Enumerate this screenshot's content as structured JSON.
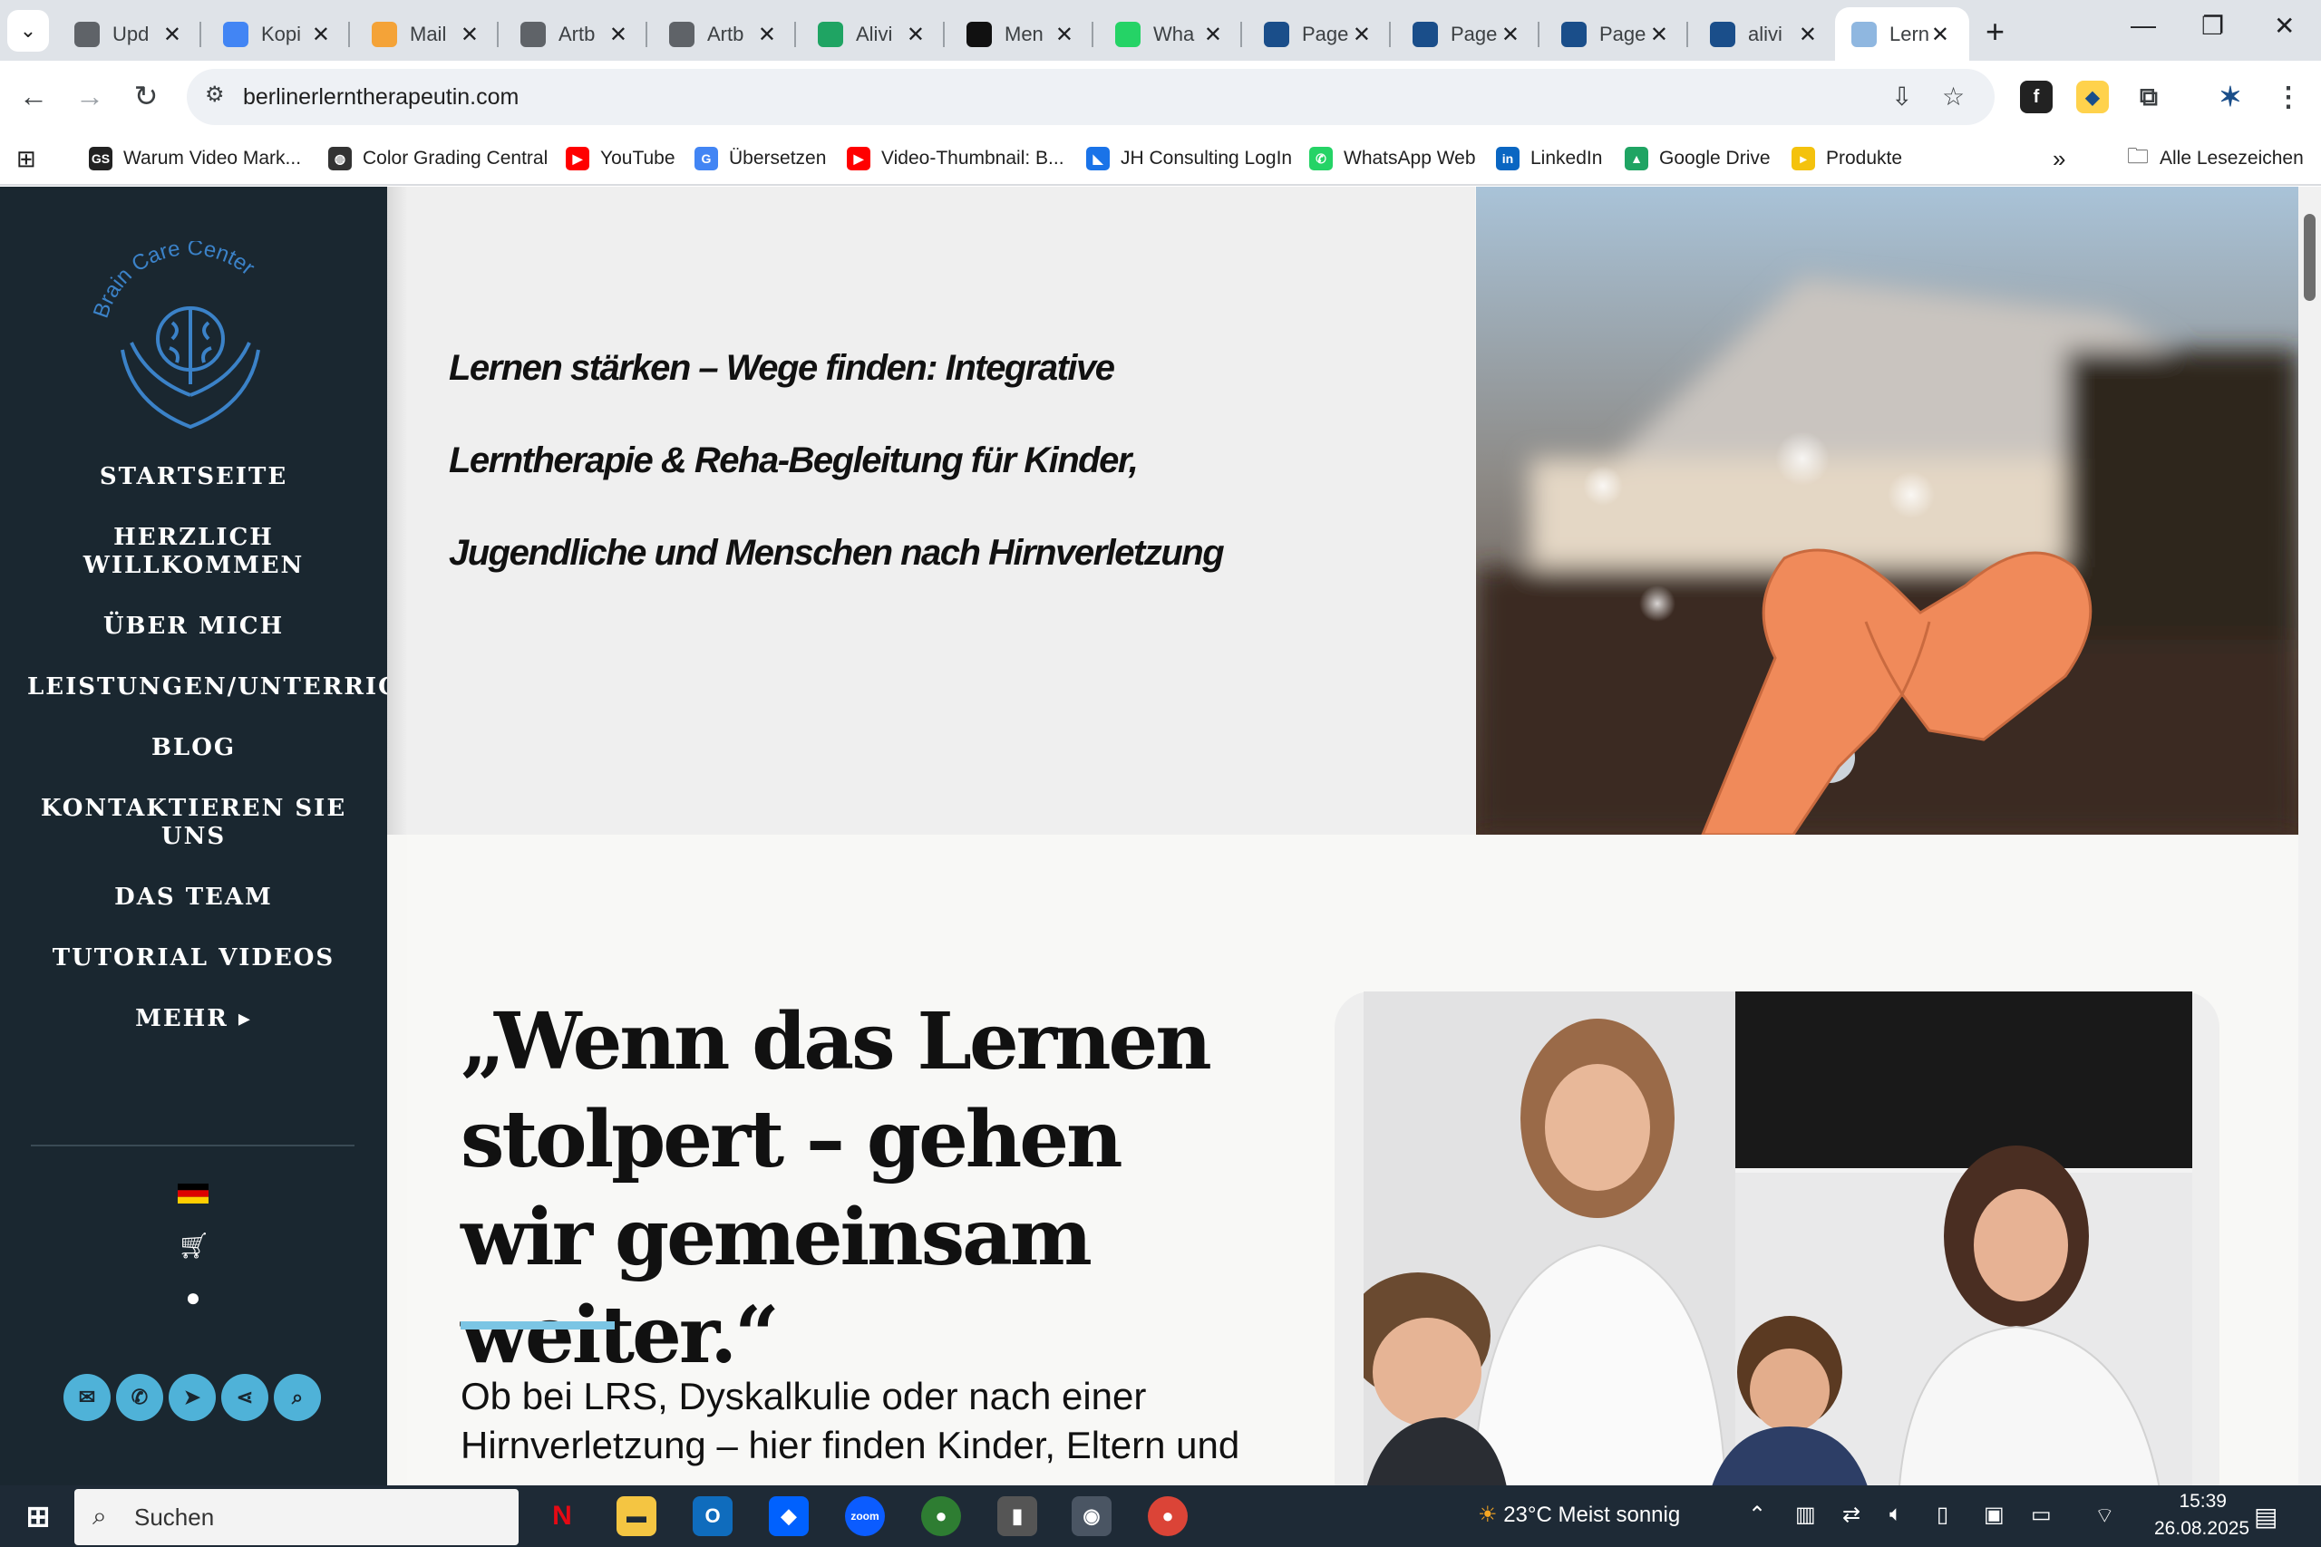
{
  "browser": {
    "tabs": [
      {
        "label": "Upd",
        "favicon": "globe-icon",
        "color": "#5f6368"
      },
      {
        "label": "Kopi",
        "favicon": "docs-icon",
        "color": "#4285f4"
      },
      {
        "label": "Mail",
        "favicon": "mail-icon",
        "color": "#f4a338"
      },
      {
        "label": "Artb",
        "favicon": "globe-icon",
        "color": "#5f6368"
      },
      {
        "label": "Artb",
        "favicon": "globe-icon",
        "color": "#5f6368"
      },
      {
        "label": "Alivi",
        "favicon": "drive-icon",
        "color": "#1fa463"
      },
      {
        "label": "Men",
        "favicon": "notion-icon",
        "color": "#111111"
      },
      {
        "label": "Wha",
        "favicon": "whatsapp-icon",
        "color": "#25d366"
      },
      {
        "label": "Page",
        "favicon": "star-spark-icon",
        "color": "#1a4e8a"
      },
      {
        "label": "Page",
        "favicon": "star-spark-icon",
        "color": "#1a4e8a"
      },
      {
        "label": "Page",
        "favicon": "star-spark-icon",
        "color": "#1a4e8a"
      },
      {
        "label": "alivi",
        "favicon": "star-spark-icon",
        "color": "#1a4e8a"
      },
      {
        "label": "Lern",
        "favicon": "site-icon",
        "color": "#8fb7e0",
        "active": true
      }
    ],
    "url": "berlinerlerntherapeutin.com",
    "bookmarks": [
      {
        "label": "Warum Video Mark...",
        "icon": "gs-icon",
        "color": "#222222",
        "glyph": "GS"
      },
      {
        "label": "Color Grading Central",
        "icon": "globe-icon",
        "color": "#333333",
        "glyph": "◍"
      },
      {
        "label": "YouTube",
        "icon": "youtube-icon",
        "color": "#ff0000",
        "glyph": "▶"
      },
      {
        "label": "Übersetzen",
        "icon": "translate-icon",
        "color": "#4285f4",
        "glyph": "G"
      },
      {
        "label": "Video-Thumbnail: B...",
        "icon": "youtube-icon",
        "color": "#ff0000",
        "glyph": "▶"
      },
      {
        "label": "JH Consulting LogIn",
        "icon": "jh-icon",
        "color": "#1a73e8",
        "glyph": "◣"
      },
      {
        "label": "WhatsApp Web",
        "icon": "whatsapp-icon",
        "color": "#25d366",
        "glyph": "✆"
      },
      {
        "label": "LinkedIn",
        "icon": "linkedin-icon",
        "color": "#0a66c2",
        "glyph": "in"
      },
      {
        "label": "Google Drive",
        "icon": "drive-icon",
        "color": "#1fa463",
        "glyph": "▲"
      },
      {
        "label": "Produkte",
        "icon": "produkte-icon",
        "color": "#f4c20d",
        "glyph": "▸"
      }
    ],
    "all_bookmarks_label": "Alle Lesezeichen"
  },
  "site": {
    "logo_text": "Brain Care Center",
    "nav": [
      "STARTSEITE",
      "HERZLICH WILLKOMMEN",
      "ÜBER MICH",
      "LEISTUNGEN/UNTERRICHTSANGEBOTE",
      "BLOG",
      "KONTAKTIEREN SIE UNS",
      "DAS TEAM",
      "TUTORIAL VIDEOS",
      "MEHR ▸"
    ],
    "hero_lines": [
      "Lernen stärken – Wege finden: Integrative",
      "Lerntherapie & Reha-Begleitung für Kinder,",
      "Jugendliche und Menschen nach Hirnverletzung"
    ],
    "quote": "„Wenn das Lernen stolpert – gehen wir gemeinsam weiter.“",
    "body_text": "Ob bei LRS, Dyskalkulie oder nach einer Hirnverletzung – hier finden Kinder, Eltern und",
    "accent_color": "#4fb2d8",
    "sidebar_color": "#1a2730"
  },
  "taskbar": {
    "search_placeholder": "Suchen",
    "weather": "23°C  Meist sonnig",
    "time": "15:39",
    "date": "26.08.2025"
  }
}
